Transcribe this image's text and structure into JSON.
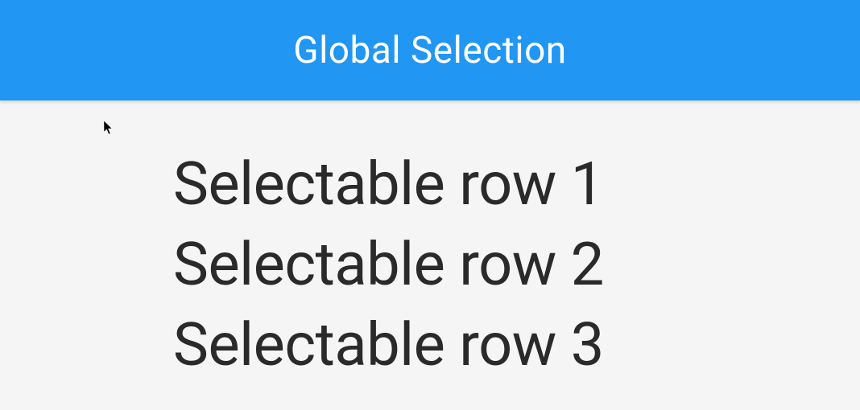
{
  "header": {
    "title": "Global Selection"
  },
  "rows": {
    "0": "Selectable row 1",
    "1": "Selectable row 2",
    "2": "Selectable row 3"
  }
}
